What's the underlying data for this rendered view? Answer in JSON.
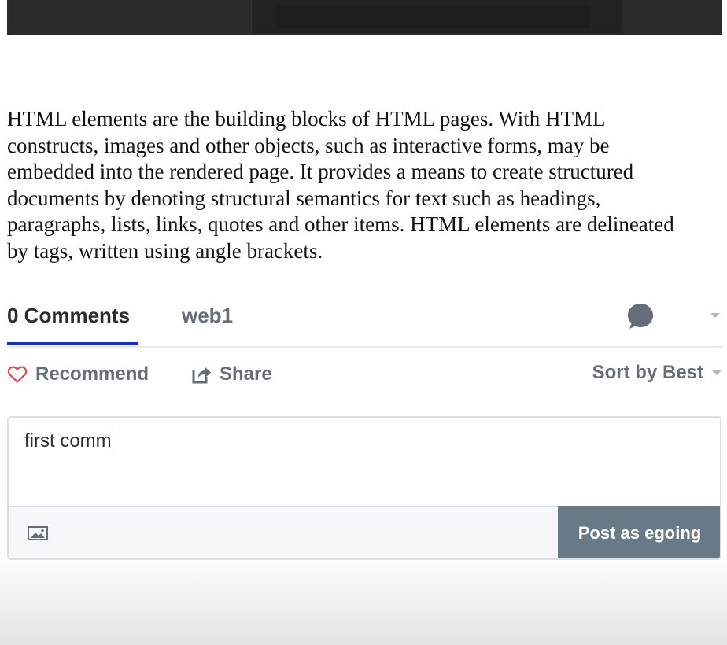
{
  "article": {
    "paragraph": "HTML elements are the building blocks of HTML pages. With HTML constructs, images and other objects, such as interactive forms, may be embedded into the rendered page. It provides a means to create structured documents by denoting structural semantics for text such as headings, paragraphs, lists, links, quotes and other items. HTML elements are delineated by tags, written using angle brackets."
  },
  "tabs": {
    "comments_label": "0 Comments",
    "forum_label": "web1",
    "notification_icon": "speech-bubble-icon",
    "menu_icon": "caret-down-icon"
  },
  "actions": {
    "recommend_label": "Recommend",
    "recommend_icon": "heart-icon",
    "share_label": "Share",
    "share_icon": "share-icon",
    "sort_label": "Sort by Best",
    "sort_icon": "caret-down-icon"
  },
  "composer": {
    "text_value": "first comm",
    "image_icon": "image-icon",
    "post_button_label": "Post as egoing"
  },
  "colors": {
    "accent_tab": "#1c2bc4",
    "heart": "#e0434f",
    "post_button": "#687a86",
    "muted_text": "#656c7a"
  }
}
